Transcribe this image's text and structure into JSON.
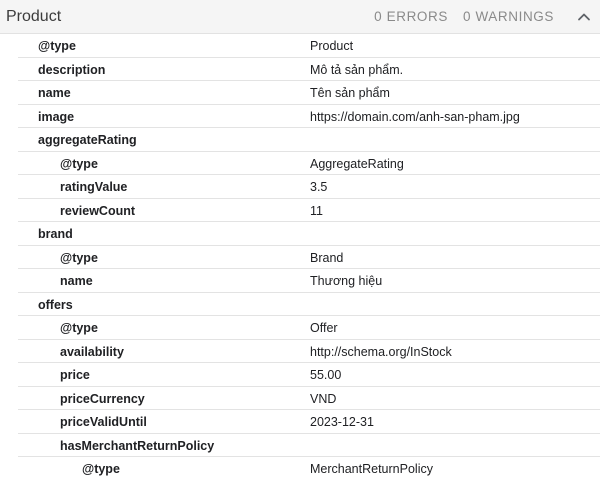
{
  "header": {
    "title": "Product",
    "errors_label": "0 ERRORS",
    "warnings_label": "0 WARNINGS",
    "collapse_icon": "chevron-up-icon"
  },
  "rows": [
    {
      "key": "@type",
      "value": "Product"
    },
    {
      "key": "description",
      "value": "Mô tả sản phẩm."
    },
    {
      "key": "name",
      "value": "Tên sản phẩm"
    },
    {
      "key": "image",
      "value": "https://domain.com/anh-san-pham.jpg"
    },
    {
      "key": "aggregateRating",
      "value": ""
    },
    {
      "key": "@type",
      "value": "AggregateRating"
    },
    {
      "key": "ratingValue",
      "value": "3.5"
    },
    {
      "key": "reviewCount",
      "value": "11"
    },
    {
      "key": "brand",
      "value": ""
    },
    {
      "key": "@type",
      "value": "Brand"
    },
    {
      "key": "name",
      "value": "Thương hiệu"
    },
    {
      "key": "offers",
      "value": ""
    },
    {
      "key": "@type",
      "value": "Offer"
    },
    {
      "key": "availability",
      "value": "http://schema.org/InStock"
    },
    {
      "key": "price",
      "value": "55.00"
    },
    {
      "key": "priceCurrency",
      "value": "VND"
    },
    {
      "key": "priceValidUntil",
      "value": "2023-12-31"
    },
    {
      "key": "hasMerchantReturnPolicy",
      "value": ""
    },
    {
      "key": "@type",
      "value": "MerchantReturnPolicy"
    }
  ]
}
